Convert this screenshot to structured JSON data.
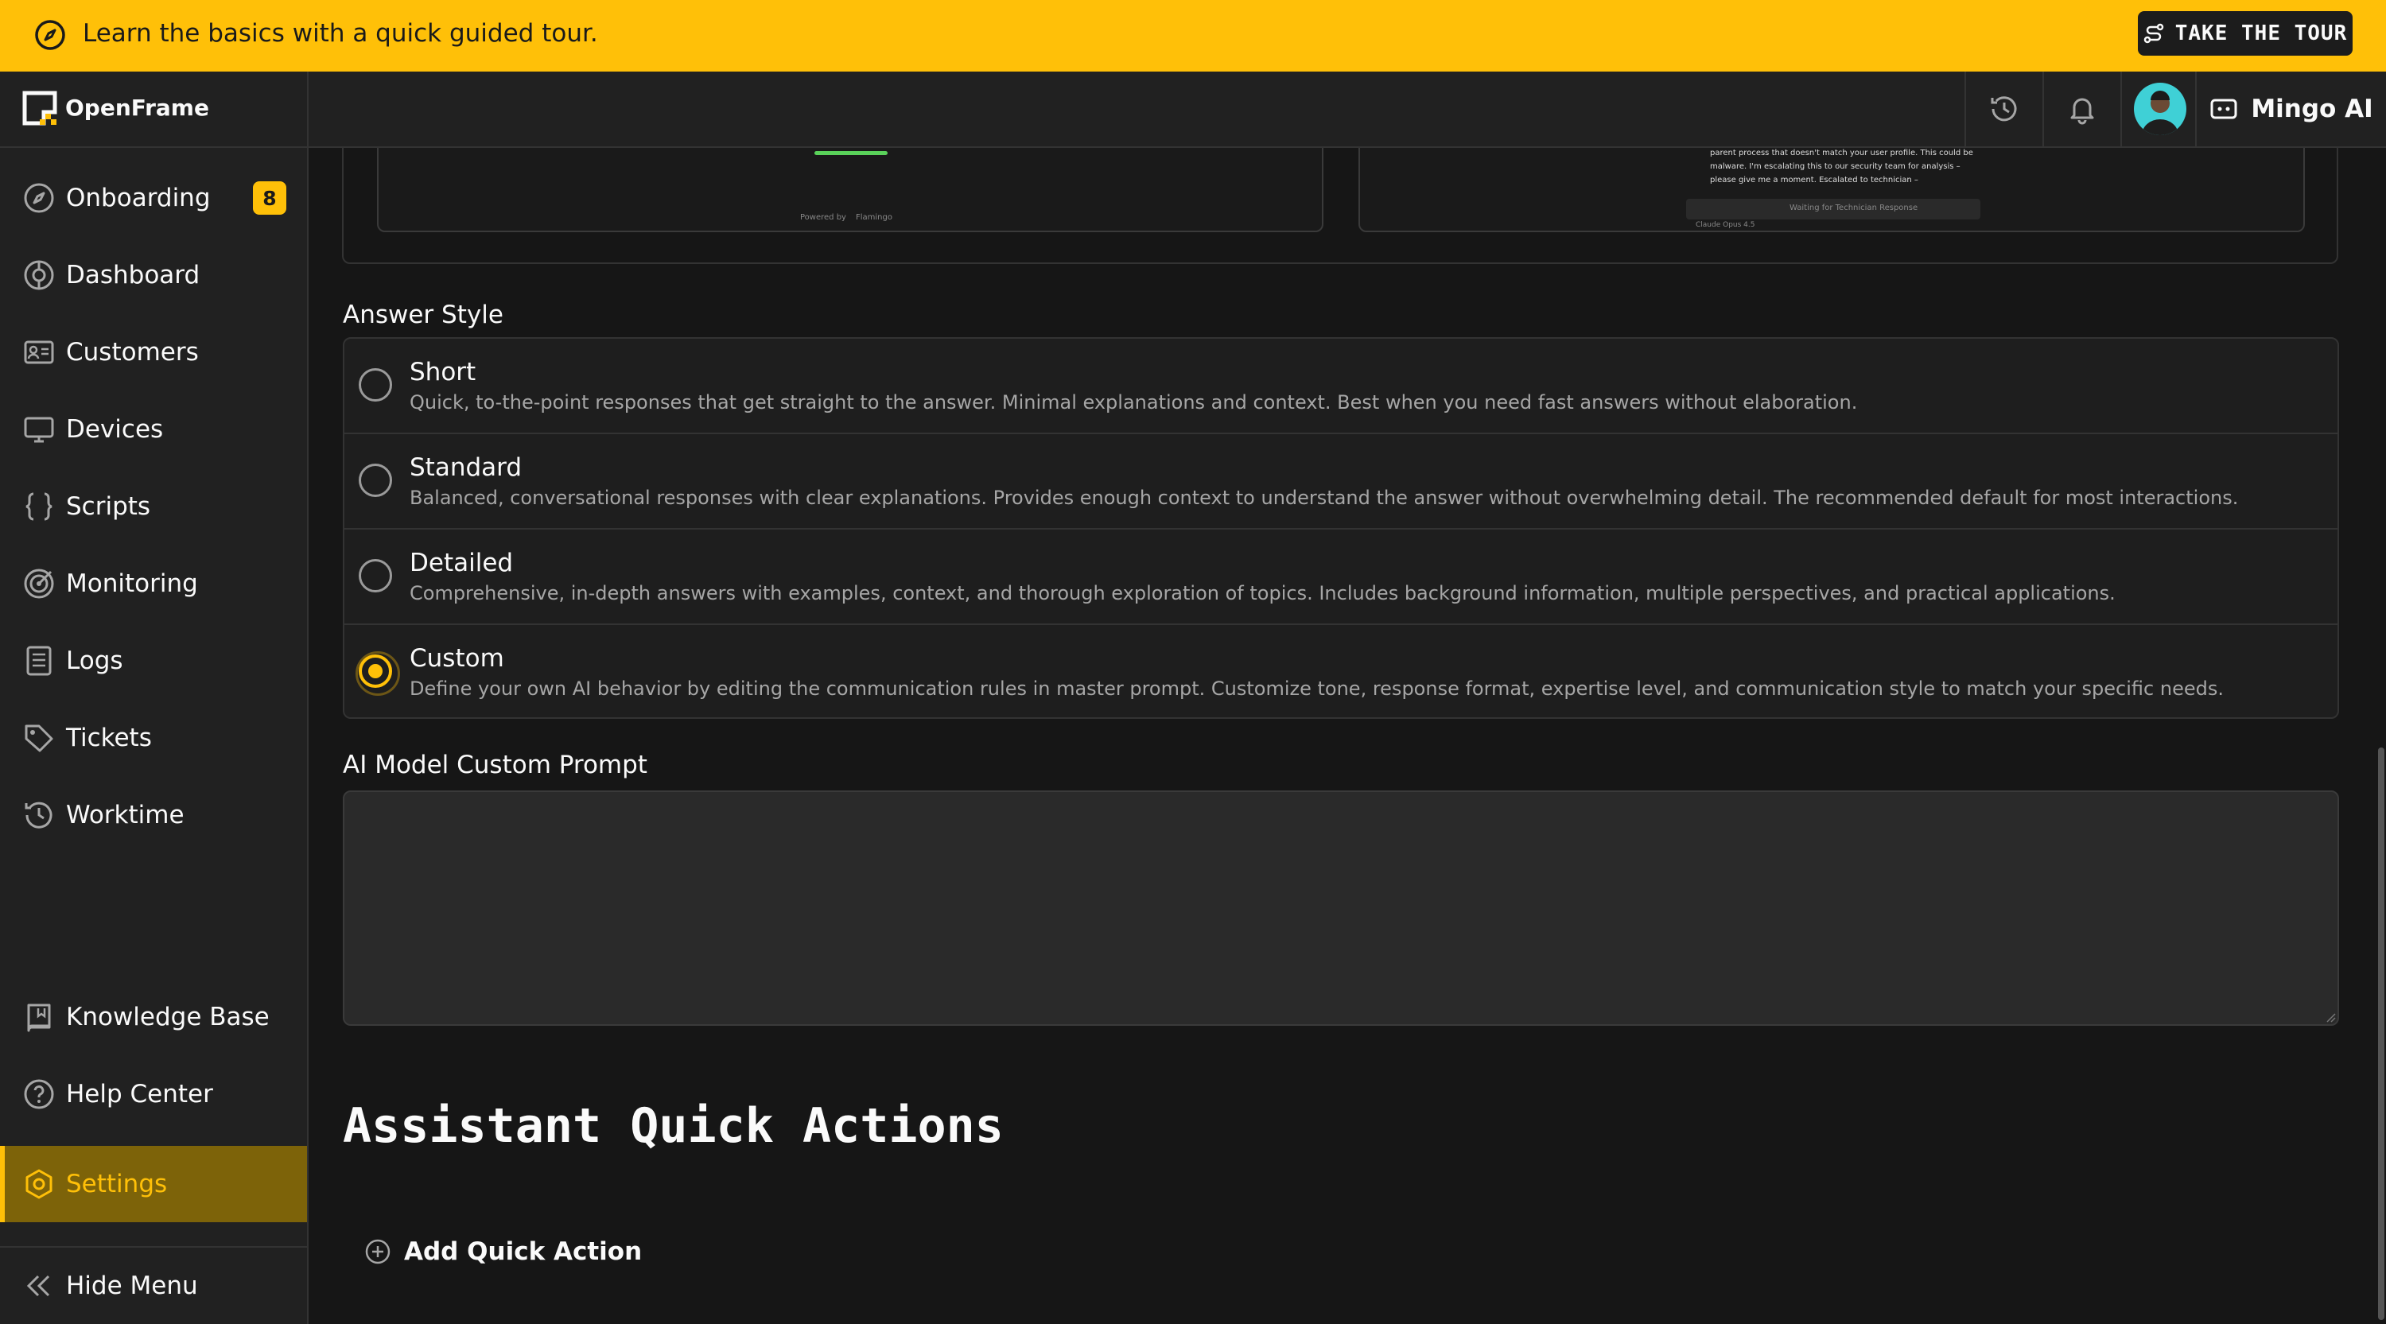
{
  "banner": {
    "text": "Learn the basics with a quick guided tour.",
    "tour_button": "TAKE THE TOUR"
  },
  "header": {
    "logo_text": "OpenFrame",
    "assistant_label": "Mingo AI"
  },
  "sidebar": {
    "items": [
      {
        "label": "Onboarding",
        "badge": "8",
        "icon": "compass-icon"
      },
      {
        "label": "Dashboard",
        "icon": "dashboard-icon"
      },
      {
        "label": "Customers",
        "icon": "id-card-icon"
      },
      {
        "label": "Devices",
        "icon": "monitor-icon"
      },
      {
        "label": "Scripts",
        "icon": "braces-icon"
      },
      {
        "label": "Monitoring",
        "icon": "target-icon"
      },
      {
        "label": "Logs",
        "icon": "list-doc-icon"
      },
      {
        "label": "Tickets",
        "icon": "tag-icon"
      },
      {
        "label": "Worktime",
        "icon": "history-icon"
      }
    ],
    "bottom_items": [
      {
        "label": "Knowledge Base",
        "icon": "book-icon"
      },
      {
        "label": "Help Center",
        "icon": "help-icon"
      },
      {
        "label": "Settings",
        "icon": "gear-icon",
        "active": true
      }
    ],
    "hide_menu": "Hide Menu"
  },
  "preview": {
    "left_footer": "Powered by",
    "left_brand": "Flamingo",
    "right_text": "parent process that doesn't match your user profile. This could be malware. I'm escalating this to our security team for analysis – please give me a moment. Escalated to technician –",
    "right_status": "Waiting for Technician Response",
    "right_model": "Claude Opus 4.5"
  },
  "answer_style": {
    "label": "Answer Style",
    "options": [
      {
        "title": "Short",
        "description": "Quick, to-the-point responses that get straight to the answer. Minimal explanations and context. Best when you need fast answers without elaboration.",
        "selected": false
      },
      {
        "title": "Standard",
        "description": "Balanced, conversational responses with clear explanations. Provides enough context to understand the answer without overwhelming detail. The recommended default for most interactions.",
        "selected": false
      },
      {
        "title": "Detailed",
        "description": "Comprehensive, in-depth answers with examples, context, and thorough exploration of topics. Includes background information, multiple perspectives, and practical applications.",
        "selected": false
      },
      {
        "title": "Custom",
        "description": "Define your own AI behavior by editing the communication rules in master prompt. Customize tone, response format, expertise level, and communication style to match your specific needs.",
        "selected": true
      }
    ]
  },
  "custom_prompt": {
    "label": "AI Model Custom Prompt",
    "value": ""
  },
  "quick_actions": {
    "title": "Assistant Quick Actions",
    "add_button": "Add Quick Action"
  },
  "colors": {
    "accent": "#ffc008",
    "background": "#161616",
    "panel": "#212121"
  }
}
